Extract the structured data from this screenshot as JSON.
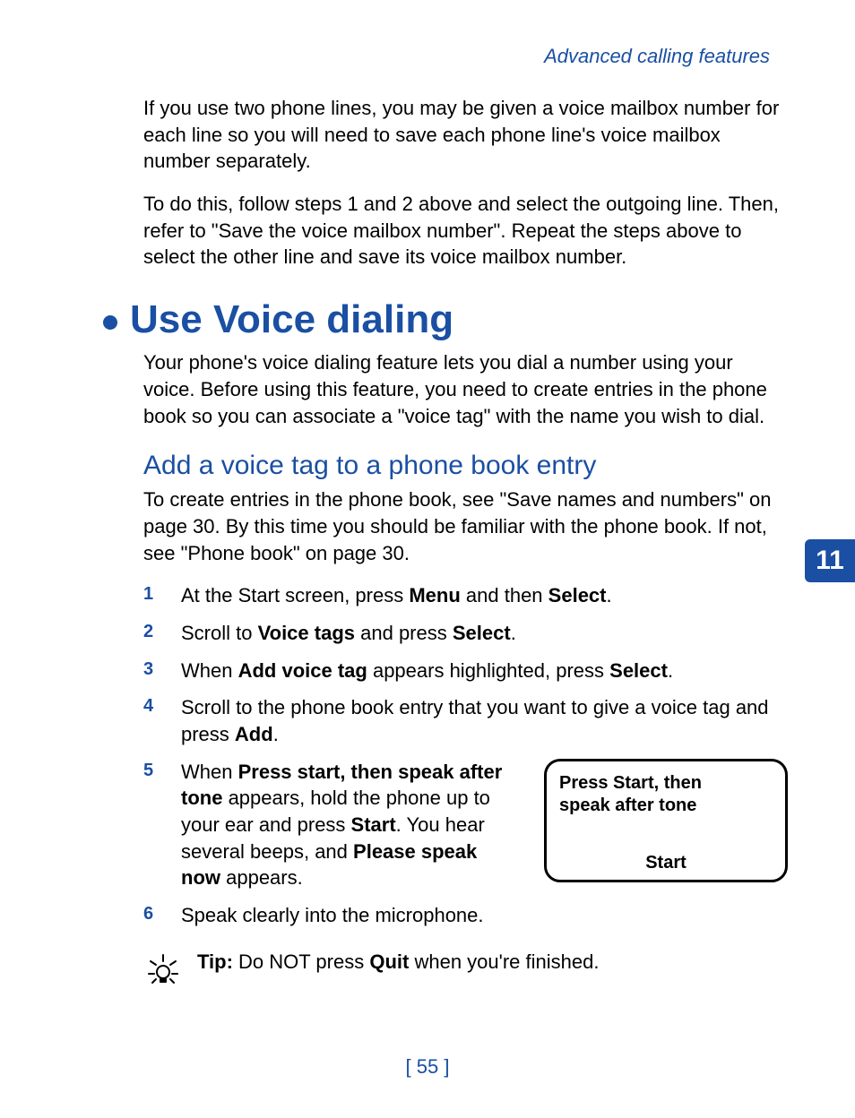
{
  "header": "Advanced calling features",
  "intro_para1": "If you use two phone lines, you may be given a voice mailbox number for each line so you will need to save each phone line's voice mailbox number separately.",
  "intro_para2": "To do this, follow steps 1 and 2 above and select the outgoing line. Then, refer to \"Save the voice mailbox number\". Repeat the steps above to select the other line and save its voice mailbox number.",
  "section_title": "Use Voice dialing",
  "section_intro": "Your phone's voice dialing feature lets you dial a number using your voice. Before using this feature, you need to create entries in the phone book so you can associate a \"voice tag\" with the name you wish to dial.",
  "sub_title": "Add a voice tag to a phone book entry",
  "sub_intro": "To create entries in the phone book, see \"Save names and numbers\" on page 30. By this time you should be familiar with the phone book. If not, see \"Phone book\" on page 30.",
  "steps": {
    "n1": "1",
    "s1_a": "At the Start screen, press ",
    "s1_b": "Menu",
    "s1_c": " and then ",
    "s1_d": "Select",
    "s1_e": ".",
    "n2": "2",
    "s2_a": "Scroll to ",
    "s2_b": "Voice tags",
    "s2_c": " and press ",
    "s2_d": "Select",
    "s2_e": ".",
    "n3": "3",
    "s3_a": "When ",
    "s3_b": "Add voice tag",
    "s3_c": " appears highlighted, press ",
    "s3_d": "Select",
    "s3_e": ".",
    "n4": "4",
    "s4_a": "Scroll to the phone book entry that you want to give a voice tag and press ",
    "s4_b": "Add",
    "s4_c": ".",
    "n5": "5",
    "s5_a": "When ",
    "s5_b": "Press start, then speak after tone",
    "s5_c": " appears, hold the phone up to your ear and press ",
    "s5_d": "Start",
    "s5_e": ". You hear several beeps, and ",
    "s5_f": "Please speak now",
    "s5_g": " appears.",
    "n6": "6",
    "s6": "Speak clearly into the microphone."
  },
  "phone_screen": {
    "line1": "Press Start, then",
    "line2": "speak after tone",
    "button": "Start"
  },
  "tip_label": "Tip:",
  "tip_a": " Do NOT press ",
  "tip_b": "Quit",
  "tip_c": " when you're finished.",
  "tab": "11",
  "page_number": "[ 55 ]"
}
